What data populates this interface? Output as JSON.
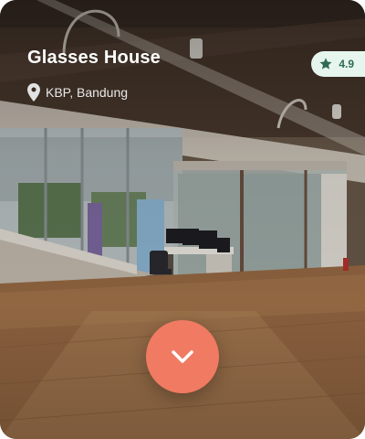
{
  "card": {
    "title": "Glasses House",
    "location": "KBP, Bandung",
    "rating": "4.9"
  },
  "icons": {
    "location": "map-pin-icon",
    "rating": "star-icon",
    "action": "chevron-down-icon"
  },
  "colors": {
    "accent": "#f07b62",
    "rating_bg": "#e6f6ee",
    "rating_text": "#2f6a56"
  }
}
